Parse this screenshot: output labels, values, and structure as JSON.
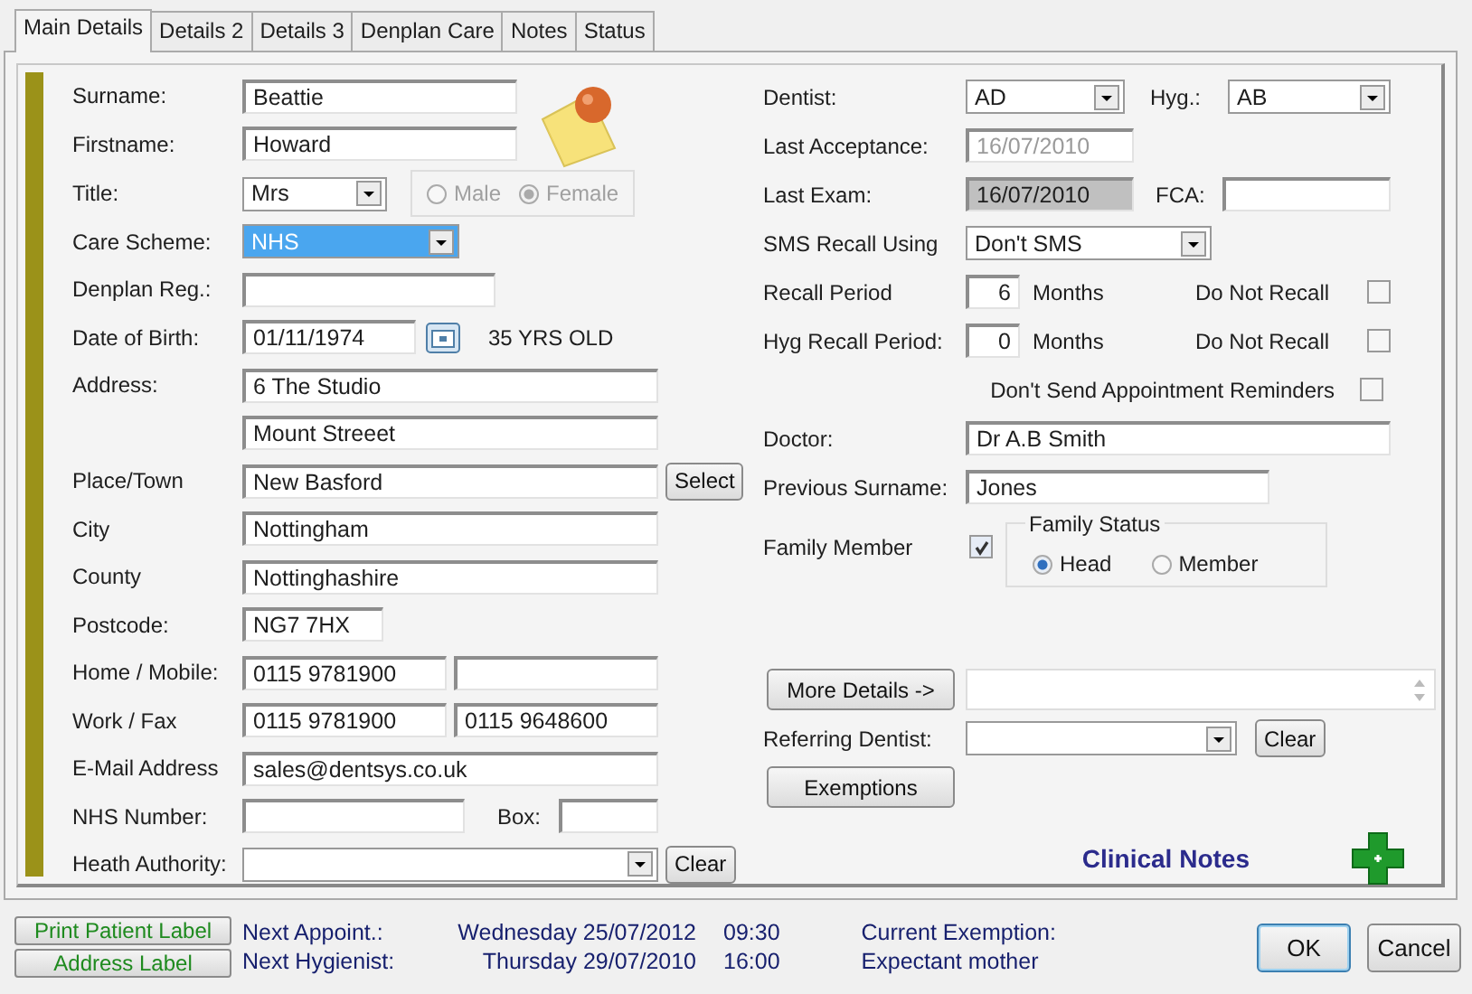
{
  "tabs": [
    {
      "label": "Main Details",
      "selected": true
    },
    {
      "label": "Details 2",
      "selected": false
    },
    {
      "label": "Details 3",
      "selected": false
    },
    {
      "label": "Denplan Care",
      "selected": false
    },
    {
      "label": "Notes",
      "selected": false
    },
    {
      "label": "Status",
      "selected": false
    }
  ],
  "left": {
    "surname": {
      "label": "Surname:",
      "value": "Beattie"
    },
    "firstname": {
      "label": "Firstname:",
      "value": "Howard"
    },
    "title": {
      "label": "Title:",
      "value": "Mrs"
    },
    "gender": {
      "disabled": true,
      "options": [
        {
          "label": "Male",
          "selected": false
        },
        {
          "label": "Female",
          "selected": true
        }
      ]
    },
    "care_scheme": {
      "label": "Care Scheme:",
      "value": "NHS",
      "focused": true
    },
    "denplan_reg": {
      "label": "Denplan Reg.:"
    },
    "dob": {
      "label": "Date of Birth:",
      "value": "01/11/1974",
      "age": "35 YRS OLD"
    },
    "address": {
      "label": "Address:",
      "lines": [
        "6 The Studio",
        "Mount Streeet"
      ]
    },
    "place_town": {
      "label": "Place/Town",
      "value": "New Basford",
      "button": "Select"
    },
    "city": {
      "label": "City",
      "value": "Nottingham"
    },
    "county": {
      "label": "County",
      "value": "Nottinghashire"
    },
    "postcode": {
      "label": "Postcode:",
      "value": "NG7 7HX"
    },
    "home_mobile": {
      "label": "Home / Mobile:",
      "home": "0115 9781900"
    },
    "work_fax": {
      "label": "Work / Fax",
      "work": "0115 9781900",
      "fax": "0115 9648600"
    },
    "email": {
      "label": "E-Mail Address",
      "value": "sales@dentsys.co.uk"
    },
    "nhs_number": {
      "label": "NHS Number:",
      "box_label": "Box:"
    },
    "health_authority": {
      "label": "Heath Authority:",
      "button": "Clear"
    }
  },
  "right": {
    "dentist": {
      "label": "Dentist:",
      "value": "AD"
    },
    "hyg": {
      "label": "Hyg.:",
      "value": "AB"
    },
    "last_acceptance": {
      "label": "Last Acceptance:",
      "value": "16/07/2010",
      "disabled": true
    },
    "last_exam": {
      "label": "Last Exam:",
      "value": "16/07/2010",
      "read_only": true
    },
    "fca": {
      "label": "FCA:"
    },
    "sms": {
      "label": "SMS Recall Using",
      "value": "Don't SMS"
    },
    "recall": {
      "label": "Recall Period",
      "value": "6",
      "unit": "Months",
      "flag_label": "Do Not Recall",
      "checked": false
    },
    "hyg_recall": {
      "label": "Hyg Recall Period:",
      "value": "0",
      "unit": "Months",
      "flag_label": "Do Not Recall",
      "checked": false
    },
    "reminders": {
      "label": "Don't Send Appointment Reminders",
      "checked": false
    },
    "doctor": {
      "label": "Doctor:",
      "value": "Dr A.B Smith"
    },
    "previous_surname": {
      "label": "Previous Surname:",
      "value": "Jones"
    },
    "family_member": {
      "label": "Family Member",
      "checked": true
    },
    "family_status": {
      "title": "Family Status",
      "options": [
        {
          "label": "Head",
          "selected": true
        },
        {
          "label": "Member",
          "selected": false
        }
      ]
    },
    "more_details": {
      "button": "More Details ->"
    },
    "referring": {
      "label": "Referring Dentist:",
      "button": "Clear"
    },
    "exemptions": {
      "button": "Exemptions"
    },
    "clinical_notes": "Clinical Notes"
  },
  "footer": {
    "label_buttons": [
      "Print Patient Label",
      "Address Label"
    ],
    "appointments": [
      {
        "label": "Next Appoint.:",
        "day": "Wednesday 25/07/2012",
        "time": "09:30"
      },
      {
        "label": "Next Hygienist:",
        "day": "Thursday 29/07/2010",
        "time": "16:00"
      }
    ],
    "exemption": {
      "label": "Current Exemption:",
      "value": "Expectant mother"
    },
    "buttons": [
      {
        "label": "OK",
        "default": true
      },
      {
        "label": "Cancel",
        "default": false
      }
    ]
  }
}
